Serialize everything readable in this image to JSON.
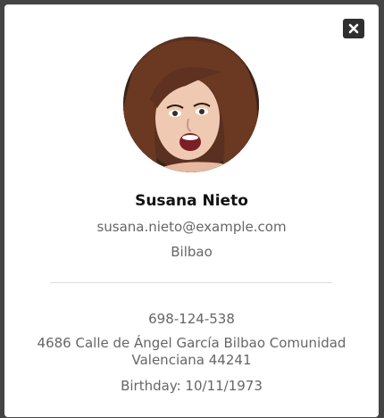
{
  "profile": {
    "name": "Susana Nieto",
    "email": "susana.nieto@example.com",
    "city": "Bilbao",
    "phone": "698-124-538",
    "address": "4686 Calle de Ángel García Bilbao Comunidad Valenciana 44241",
    "birthday": "Birthday: 10/11/1973"
  },
  "icons": {
    "close": "close-icon",
    "avatar": "profile-photo"
  },
  "colors": {
    "overlay": "#444444",
    "modal_bg": "#ffffff",
    "close_bg": "#2f2f2f",
    "name_text": "#111111",
    "secondary_text": "#666666",
    "divider": "#dddddd"
  }
}
